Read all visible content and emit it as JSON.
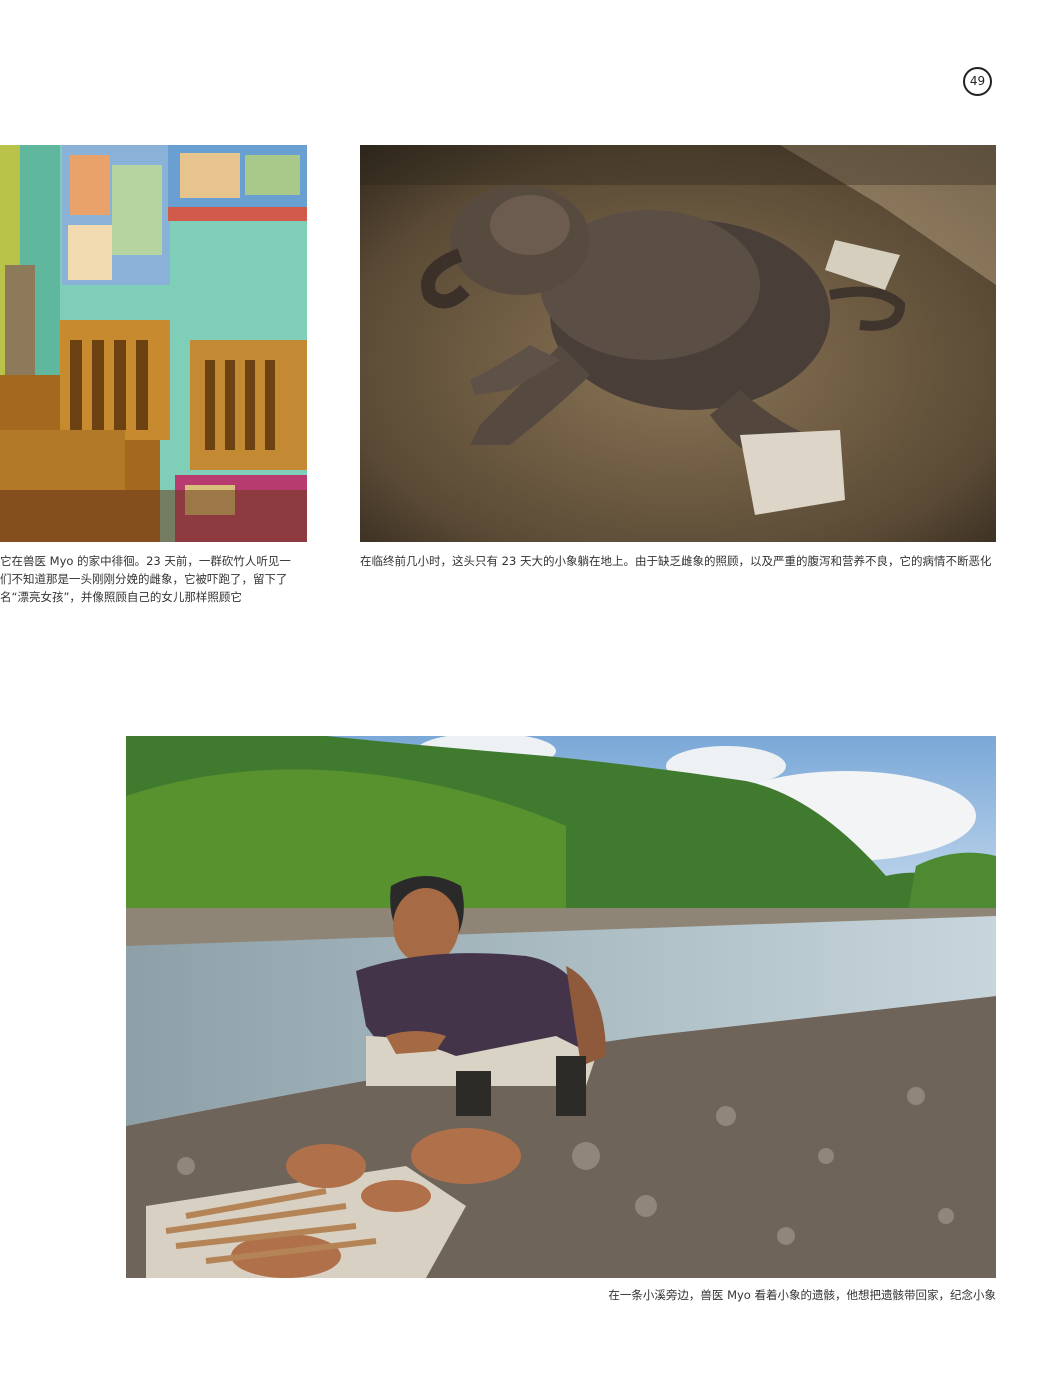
{
  "page": {
    "number": "49"
  },
  "captions": {
    "left_lines": [
      "它在兽医 Myo 的家中徘徊。23 天前，一群砍竹人听见一",
      "们不知道那是一头刚刚分娩的雌象，它被吓跑了，留下了",
      "名“漂亮女孩”，并像照顾自己的女儿那样照顾它"
    ],
    "right": "在临终前几小时，这头只有 23 天大的小象躺在地上。由于缺乏雌象的照顾，以及严重的腹泻和营养不良，它的病情不断恶化",
    "bottom": "在一条小溪旁边，兽医 Myo 看着小象的遗骸，他想把遗骸带回家，纪念小象"
  }
}
